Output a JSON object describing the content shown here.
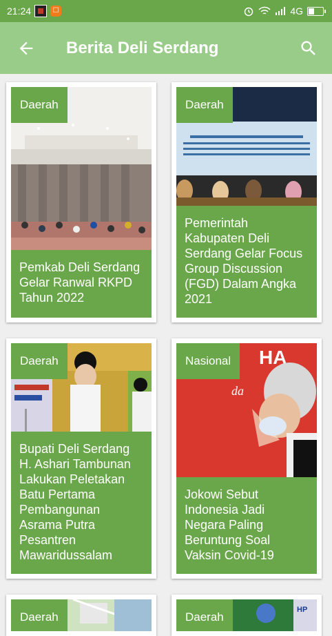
{
  "status_bar": {
    "time": "21:24",
    "network": "4G"
  },
  "app_bar": {
    "title": "Berita Deli Serdang",
    "back_icon": "arrow-back-icon",
    "search_icon": "search-icon"
  },
  "colors": {
    "primary": "#6aa64a",
    "app_bar": "#9acc89",
    "background": "#efefef"
  },
  "news": [
    {
      "category": "Daerah",
      "title": "Pemkab Deli Serdang Gelar Ranwal RKPD Tahun 2022"
    },
    {
      "category": "Daerah",
      "title": "Pemerintah Kabupaten Deli Serdang Gelar Focus Group Discussion (FGD) Dalam Angka 2021"
    },
    {
      "category": "Daerah",
      "title": "Bupati Deli Serdang H. Ashari Tambunan Lakukan Peletakan Batu Pertama Pembangunan Asrama Putra Pesantren Mawaridussalam"
    },
    {
      "category": "Nasional",
      "title": "Jokowi Sebut Indonesia Jadi Negara Paling Beruntung Soal Vaksin Covid-19"
    },
    {
      "category": "Daerah",
      "title": ""
    },
    {
      "category": "Daerah",
      "title": ""
    }
  ]
}
